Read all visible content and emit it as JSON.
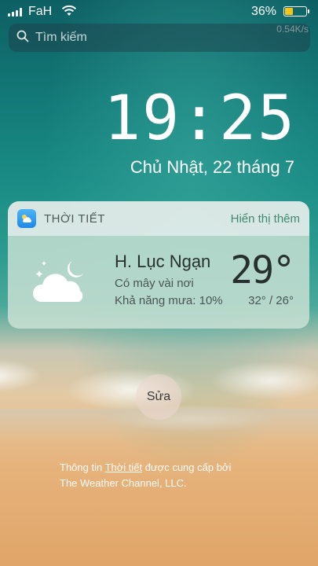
{
  "status_bar": {
    "carrier": "FaH",
    "battery_percent": "36%",
    "battery_level": 0.36,
    "net_speed": "0.54K/s"
  },
  "search": {
    "placeholder": "Tìm kiếm"
  },
  "lock": {
    "time": "19:25",
    "date": "Chủ Nhật, 22 tháng 7"
  },
  "widget": {
    "app_name": "THỜI TIẾT",
    "more_label": "Hiển thị thêm",
    "city": "H. Lục Ngạn",
    "condition": "Có mây vài nơi",
    "rain_chance": "Khả năng mưa: 10%",
    "temperature": "29°",
    "range": "32° / 26°",
    "icon": "partly-cloudy-night-icon"
  },
  "edit_button": {
    "label": "Sửa"
  },
  "credit": {
    "prefix": "Thông tin ",
    "link": "Thời tiết",
    "suffix": " được cung cấp bởi",
    "line2": "The Weather Channel, LLC."
  },
  "colors": {
    "battery": "#f5c518",
    "accent_link": "#3d8a6e"
  }
}
